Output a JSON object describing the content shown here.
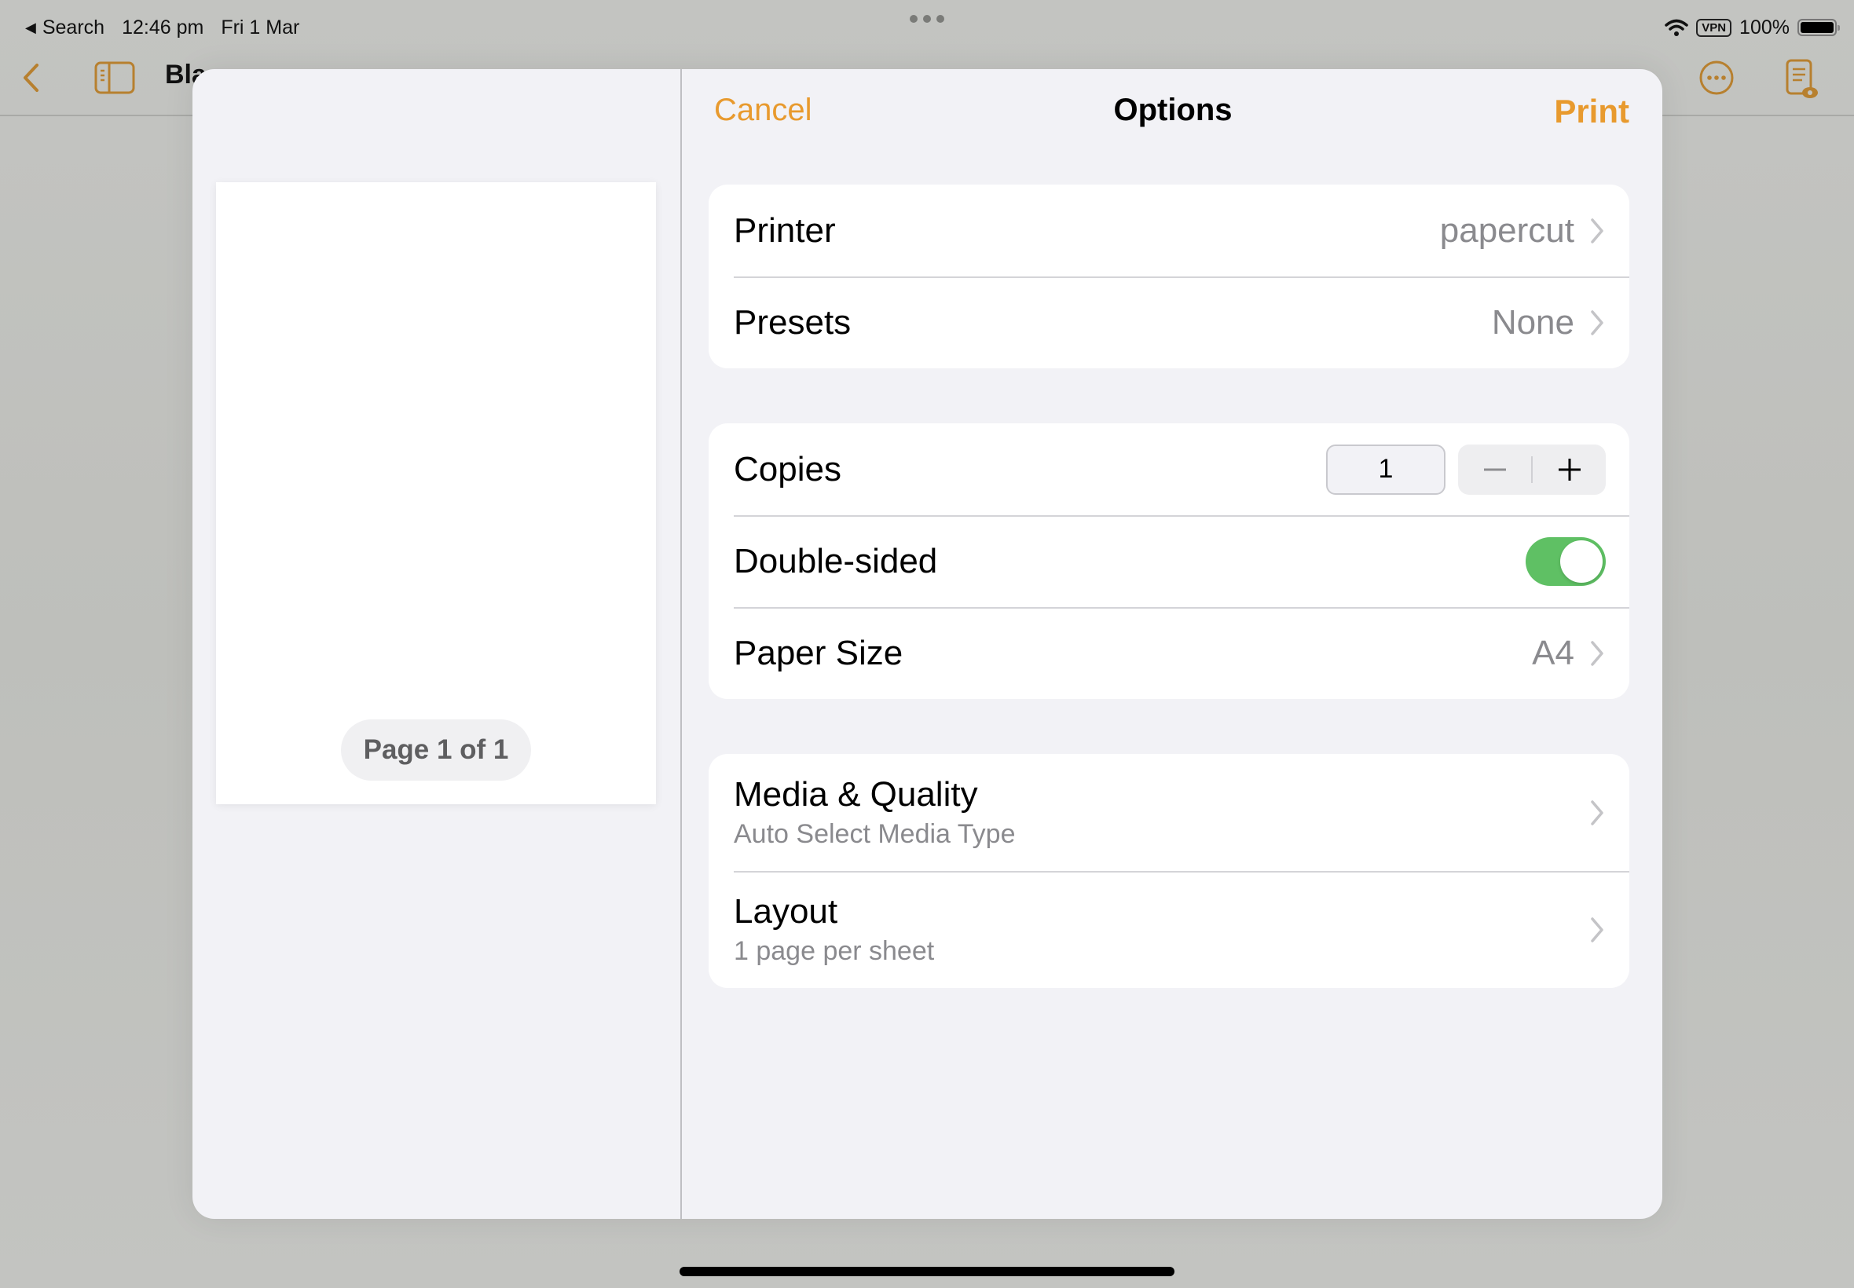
{
  "status_bar": {
    "back_app": "Search",
    "time": "12:46 pm",
    "date": "Fri 1 Mar",
    "vpn": "VPN",
    "battery": "100%",
    "battery_level": 1.0
  },
  "app": {
    "document_title_partial": "Bla"
  },
  "print_dialog": {
    "header": {
      "cancel_label": "Cancel",
      "title": "Options",
      "print_label": "Print"
    },
    "preview": {
      "page_indicator": "Page 1 of 1"
    },
    "groups": [
      {
        "rows": [
          {
            "label": "Printer",
            "value": "papercut"
          },
          {
            "label": "Presets",
            "value": "None"
          }
        ]
      },
      {
        "rows": [
          {
            "label": "Copies",
            "value": "1"
          },
          {
            "label": "Double-sided",
            "toggle_on": true
          },
          {
            "label": "Paper Size",
            "value": "A4"
          }
        ]
      },
      {
        "rows": [
          {
            "label": "Media & Quality",
            "subtitle": "Auto Select Media Type"
          },
          {
            "label": "Layout",
            "subtitle": "1 page per sheet"
          }
        ]
      }
    ]
  },
  "colors": {
    "accent": "#e89a2e",
    "toggle_on": "#5fc064",
    "toolbar_icon": "#b7802f",
    "secondary_text": "#8a8a8e",
    "sheet_background": "#f2f2f6"
  },
  "icons": {
    "back": "chevron-left",
    "sidebar": "sidebar-toggle",
    "share": "square-and-arrow-up",
    "more": "ellipsis-circle",
    "reader": "doc-eye",
    "wifi": "wifi",
    "battery": "battery-full"
  }
}
